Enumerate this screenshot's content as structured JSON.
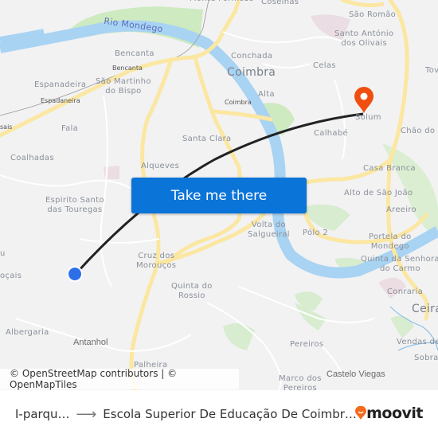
{
  "map": {
    "labels": {
      "rio_mondego": "Rio Mondego",
      "monte_formoso": "Monte Formoso",
      "coselhas": "Coselhas",
      "sao_romao": "São Romão",
      "santo_antonio": "Santo António\ndos Olivais",
      "tovim": "Tov",
      "conchada": "Conchada",
      "coimbra": "Coimbra",
      "celas": "Celas",
      "alta": "Alta",
      "coimbra_station": "Coimbra",
      "solum": "Solum",
      "calhabe": "Calhabé",
      "chao_do": "Chão do",
      "bencanta": "Bencanta",
      "bencanta_station": "Bencanta",
      "espanadeira": "Espanadeira",
      "espadaneira_station": "Espadaneira",
      "sao_martinho": "São Martinho\ndo Bispo",
      "sais": "sais",
      "fala": "Fala",
      "coalhadas": "Coalhadas",
      "santa_clara": "Santa Clara",
      "alqueves": "Alqueves",
      "casa_branca": "Casa Branca",
      "espirito_santo": "Espirito Santo\ndas Touregas",
      "alto_sao_joao": "Alto de São João",
      "areeiro": "Areeiro",
      "volta_salgueiral": "Volta do\nSalgueiral",
      "polo2": "Pólo 2",
      "portela": "Portela do\nMondego",
      "quinta_senhora": "Quinta da Senhora\ndo Carmo",
      "u": "u",
      "bocais": "oçais",
      "cruz_morouços": "Cruz dos\nMorouços",
      "quinta_rossio": "Quinta do\nRossio",
      "conraria": "Conraria",
      "ceira": "Ceira",
      "albergaria": "Albergaria",
      "antanhol": "Antanhol",
      "pereiros": "Pereiros",
      "vendas": "Vendas de",
      "sobral": "Sobra",
      "palheira": "Palheira",
      "marco": "Marco dos\nPereiros",
      "castelo_viegas": "Castelo Viegas"
    },
    "colors": {
      "land": "#f2f2f3",
      "water": "#a9d3f2",
      "road": "#fbe7a1",
      "park": "#cdeac0",
      "route": "#222222",
      "origin": "#2d6fe8",
      "destination": "#f04e0f"
    },
    "attribution": "© OpenStreetMap contributors | © OpenMapTiles"
  },
  "cta": {
    "label": "Take me there"
  },
  "footer": {
    "origin": "I-parqu…",
    "arrow": "⟶",
    "destination": "Escola Superior De Educação De Coimbr…",
    "brand": "moovit",
    "brand_color": "#f26a1b"
  }
}
